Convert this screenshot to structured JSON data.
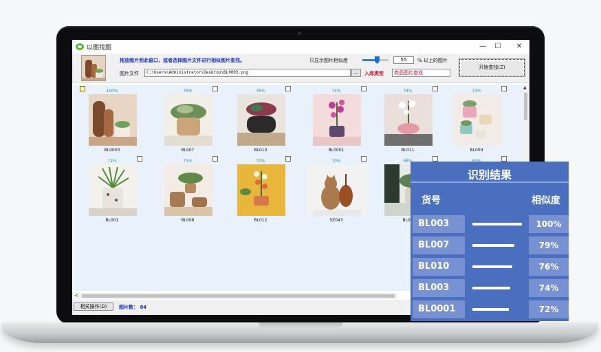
{
  "window": {
    "title": "以图找图",
    "minimize": "—",
    "maximize": "☐",
    "close": "✕"
  },
  "toolbar": {
    "hint": "拖放图片到此窗口，或者选择图片文件进行相似图片查找。",
    "file_label": "图片文件",
    "file_path": "C:\\Users\\Administrator\\Desktop\\BL0003.png",
    "browse_label": "...",
    "similarity_label": "只显示图片相似度",
    "similarity_value": "55",
    "similarity_fraction": 0.55,
    "similarity_suffix": "% 以上的图片",
    "library_label": "入库类型",
    "library_value": "商品图片查找",
    "start_button": "开始查找(Z)"
  },
  "results": [
    {
      "code": "BL0003",
      "similarity": "100%",
      "checked": true,
      "scene": "pots-wood"
    },
    {
      "code": "BL007",
      "similarity": "79%",
      "checked": false,
      "scene": "basket-plant"
    },
    {
      "code": "BL010",
      "similarity": "76%",
      "checked": false,
      "scene": "black-pot"
    },
    {
      "code": "BL0001",
      "similarity": "74%",
      "checked": false,
      "scene": "pink-orchid"
    },
    {
      "code": "BL011",
      "similarity": "74%",
      "checked": false,
      "scene": "white-orchid-pink"
    },
    {
      "code": "BL009",
      "similarity": "73%",
      "checked": false,
      "scene": "teal-pots"
    },
    {
      "code": "BL001",
      "similarity": "72%",
      "checked": false,
      "scene": "grass-planter"
    },
    {
      "code": "BL008",
      "similarity": "71%",
      "checked": false,
      "scene": "rattan-plant"
    },
    {
      "code": "BL012",
      "similarity": "70%",
      "checked": false,
      "scene": "yellow-orchid"
    },
    {
      "code": "SZ043",
      "similarity": "70%",
      "checked": false,
      "scene": "cat-cello"
    },
    {
      "code": "BL00",
      "similarity": "68%",
      "checked": false,
      "scene": "dark-plant"
    },
    {
      "code": "",
      "similarity": "65%",
      "checked": false,
      "scene": "hidden"
    }
  ],
  "status": {
    "related_button": "相关操作(D)",
    "count_label": "图片数：",
    "count_value": "84"
  },
  "panel": {
    "title": "识别结果",
    "col_code": "货号",
    "col_similarity": "相似度",
    "rows": [
      {
        "code": "BL003",
        "similarity": "100%",
        "bar": 1.0
      },
      {
        "code": "BL007",
        "similarity": "79%",
        "bar": 0.85
      },
      {
        "code": "BL010",
        "similarity": "76%",
        "bar": 0.8
      },
      {
        "code": "BL003",
        "similarity": "74%",
        "bar": 0.77
      },
      {
        "code": "BL0001",
        "similarity": "72%",
        "bar": 0.74
      }
    ]
  },
  "colors": {
    "panel_bg": "#4a6fbf",
    "panel_cell": "#7891d3",
    "hint_text": "#1a37c9",
    "library_text": "#c8102e",
    "percent_text": "#2f8fa0",
    "results_bg": "#e9f1fb"
  }
}
